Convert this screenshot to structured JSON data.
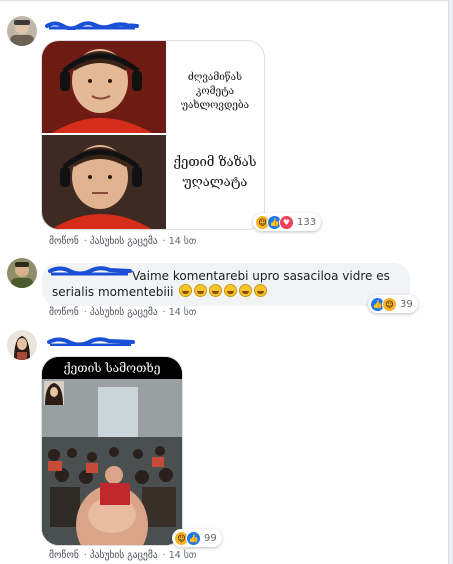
{
  "comments": [
    {
      "meme": {
        "top_text": "ძღვამიწას კომეტა უახლოვდება",
        "bottom_text": "ქეთიმ ზაზას უღალატა"
      },
      "actions": [
        "მოწონ",
        "პასუხის გაცემა",
        "14 სთ"
      ],
      "reactions": {
        "icons": [
          "haha-icon",
          "like-icon",
          "love-icon"
        ],
        "count": "133"
      }
    },
    {
      "text": "Vaime komentarebi upro sasaciloa vidre es serialis momentebiii",
      "emoji_count": 6,
      "actions": [
        "მოწონ",
        "პასუხის გაცემა",
        "14 სთ"
      ],
      "reactions": {
        "icons": [
          "like-icon",
          "haha-icon"
        ],
        "count": "39"
      }
    },
    {
      "meme": {
        "top_text": "ქეთის სამოთხე"
      },
      "actions": [
        "მოწონ",
        "პასუხის გაცემა",
        "14 სთ"
      ],
      "reactions": {
        "icons": [
          "haha-icon",
          "like-icon"
        ],
        "count": "99"
      }
    }
  ],
  "colors": {
    "scribble": "#1a4fd6",
    "bubble": "#f2f3f5",
    "link": "#4b4f56"
  }
}
